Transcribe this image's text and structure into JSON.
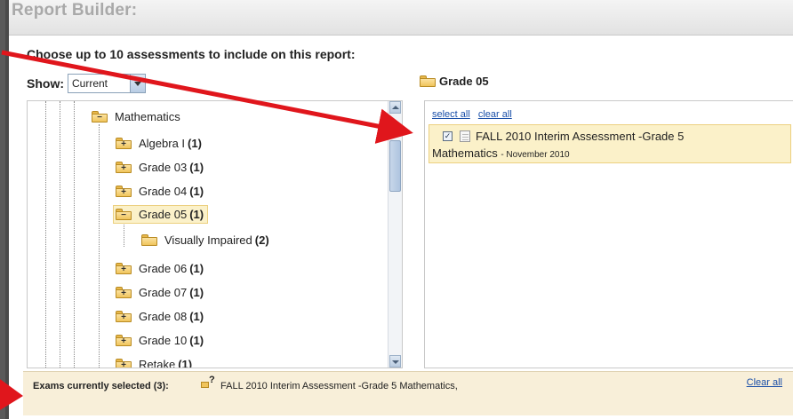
{
  "title": "Report Builder:",
  "instruction": "Choose up to 10 assessments to include on this report:",
  "show": {
    "label": "Show:",
    "value": "Current"
  },
  "right_header": {
    "label": "Grade 05"
  },
  "tree": {
    "root": {
      "label": "Mathematics"
    },
    "items": [
      {
        "label": "Algebra I",
        "count": "(1)"
      },
      {
        "label": "Grade 03",
        "count": "(1)"
      },
      {
        "label": "Grade 04",
        "count": "(1)"
      },
      {
        "label": "Grade 05",
        "count": "(1)"
      },
      {
        "label": "Visually Impaired",
        "count": "(2)"
      },
      {
        "label": "Grade 06",
        "count": "(1)"
      },
      {
        "label": "Grade 07",
        "count": "(1)"
      },
      {
        "label": "Grade 08",
        "count": "(1)"
      },
      {
        "label": "Grade 10",
        "count": "(1)"
      },
      {
        "label": "Retake",
        "count": "(1)"
      }
    ]
  },
  "results": {
    "select_all": "select all",
    "clear_all": "clear all",
    "assessment": {
      "title": "FALL 2010 Interim Assessment -Grade 5",
      "subject": "Mathematics",
      "date": "- November 2010",
      "checked": true
    }
  },
  "footer": {
    "label": "Exams currently selected (3):",
    "selected_text": "FALL 2010 Interim Assessment -Grade 5 Mathematics,",
    "clear_all": "Clear all"
  },
  "annotation_color": "#e0161c"
}
